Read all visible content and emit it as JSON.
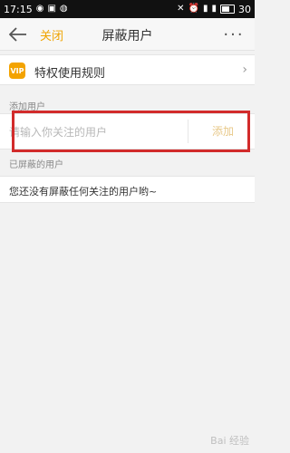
{
  "status_bar": {
    "time": "17:15",
    "battery": "30"
  },
  "header": {
    "close_label": "关闭",
    "title": "屏蔽用户",
    "more_label": "···"
  },
  "rules": {
    "icon_text": "VIP",
    "label": "特权使用规则"
  },
  "add_section": {
    "label": "添加用户",
    "input_placeholder": "请输入你关注的用户",
    "add_button": "添加"
  },
  "blocked_section": {
    "label": "已屏蔽的用户",
    "empty_text": "您还没有屏蔽任何关注的用户哟~"
  },
  "watermark": "Bai 经验",
  "colors": {
    "accent": "#f0a400",
    "highlight": "#d22b2b"
  }
}
